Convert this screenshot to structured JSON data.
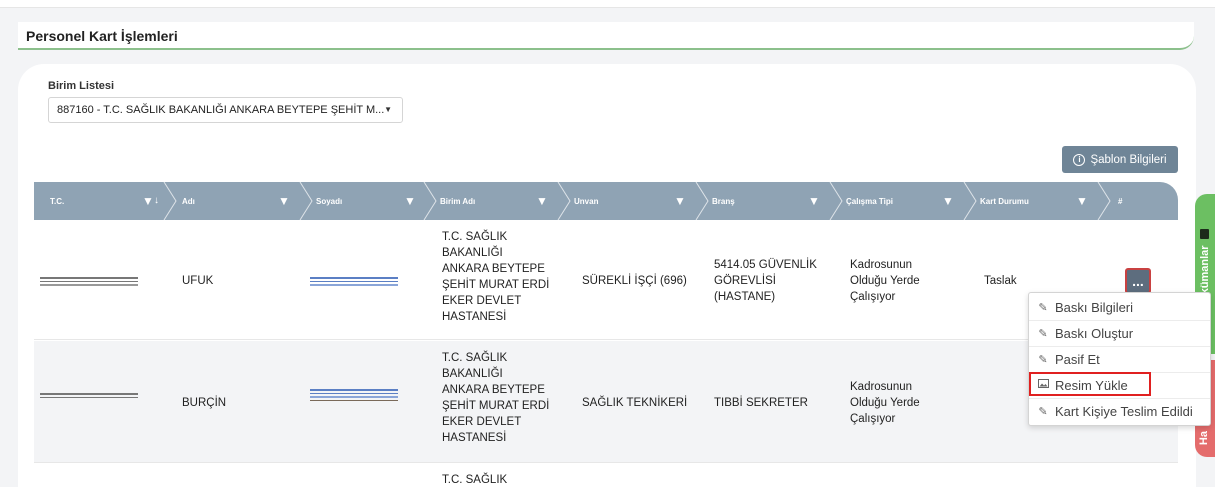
{
  "page": {
    "title": "Personel Kart İşlemleri"
  },
  "unit_filter": {
    "label": "Birim Listesi",
    "selected": "887160 - T.C. SAĞLIK BAKANLIĞI ANKARA BEYTEPE ŞEHİT M..."
  },
  "template_button": {
    "label": "Şablon Bilgileri",
    "icon": "info-icon"
  },
  "table": {
    "columns": [
      {
        "label": "T.C."
      },
      {
        "label": "Adı"
      },
      {
        "label": "Soyadı"
      },
      {
        "label": "Birim Adı"
      },
      {
        "label": "Unvan"
      },
      {
        "label": "Branş"
      },
      {
        "label": "Çalışma Tipi"
      },
      {
        "label": "Kart Durumu"
      },
      {
        "label": "#"
      }
    ],
    "sort_indicator": "↓",
    "rows": [
      {
        "first_name": "UFUK",
        "unit_lines": [
          "T.C. SAĞLIK",
          "BAKANLIĞI",
          "ANKARA BEYTEPE",
          "ŞEHİT MURAT ERDİ",
          "EKER DEVLET",
          "HASTANESİ"
        ],
        "title": "SÜREKLİ İŞÇİ (696)",
        "branch_lines": [
          "5414.05 GÜVENLİK",
          "GÖREVLİSİ",
          "(HASTANE)"
        ],
        "work_type_lines": [
          "Kadrosunun",
          "Olduğu Yerde",
          "Çalışıyor"
        ],
        "card_status": "Taslak",
        "action": "..."
      },
      {
        "first_name": "BURÇİN",
        "unit_lines": [
          "T.C. SAĞLIK",
          "BAKANLIĞI",
          "ANKARA BEYTEPE",
          "ŞEHİT MURAT ERDİ",
          "EKER DEVLET",
          "HASTANESİ"
        ],
        "title": "SAĞLIK TEKNİKERİ",
        "branch_lines": [
          "TIBBİ SEKRETER"
        ],
        "work_type_lines": [
          "Kadrosunun",
          "Olduğu Yerde",
          "Çalışıyor"
        ],
        "card_status": "",
        "action": ""
      },
      {
        "first_name": "",
        "unit_lines": [
          "T.C. SAĞLIK"
        ],
        "title": "",
        "branch_lines": [],
        "work_type_lines": [],
        "card_status": "",
        "action": ""
      }
    ]
  },
  "context_menu": {
    "items": [
      {
        "label": "Baskı Bilgileri",
        "icon": "pencil-icon"
      },
      {
        "label": "Baskı Oluştur",
        "icon": "pencil-icon"
      },
      {
        "label": "Pasif Et",
        "icon": "pencil-icon"
      },
      {
        "label": "Resim Yükle",
        "icon": "image-icon"
      },
      {
        "label": "Kart Kişiye Teslim Edildi",
        "icon": "pencil-icon"
      }
    ]
  },
  "side_tabs": {
    "documents": {
      "label": "Dokümanlar",
      "icon": "book-icon"
    },
    "help": {
      "label": "Ha"
    }
  },
  "colors": {
    "header_bg": "#8fa3b4",
    "accent_green": "#6cbf62",
    "accent_red": "#e46c6c",
    "button_bg": "#6f8597",
    "highlight": "#e02020"
  }
}
